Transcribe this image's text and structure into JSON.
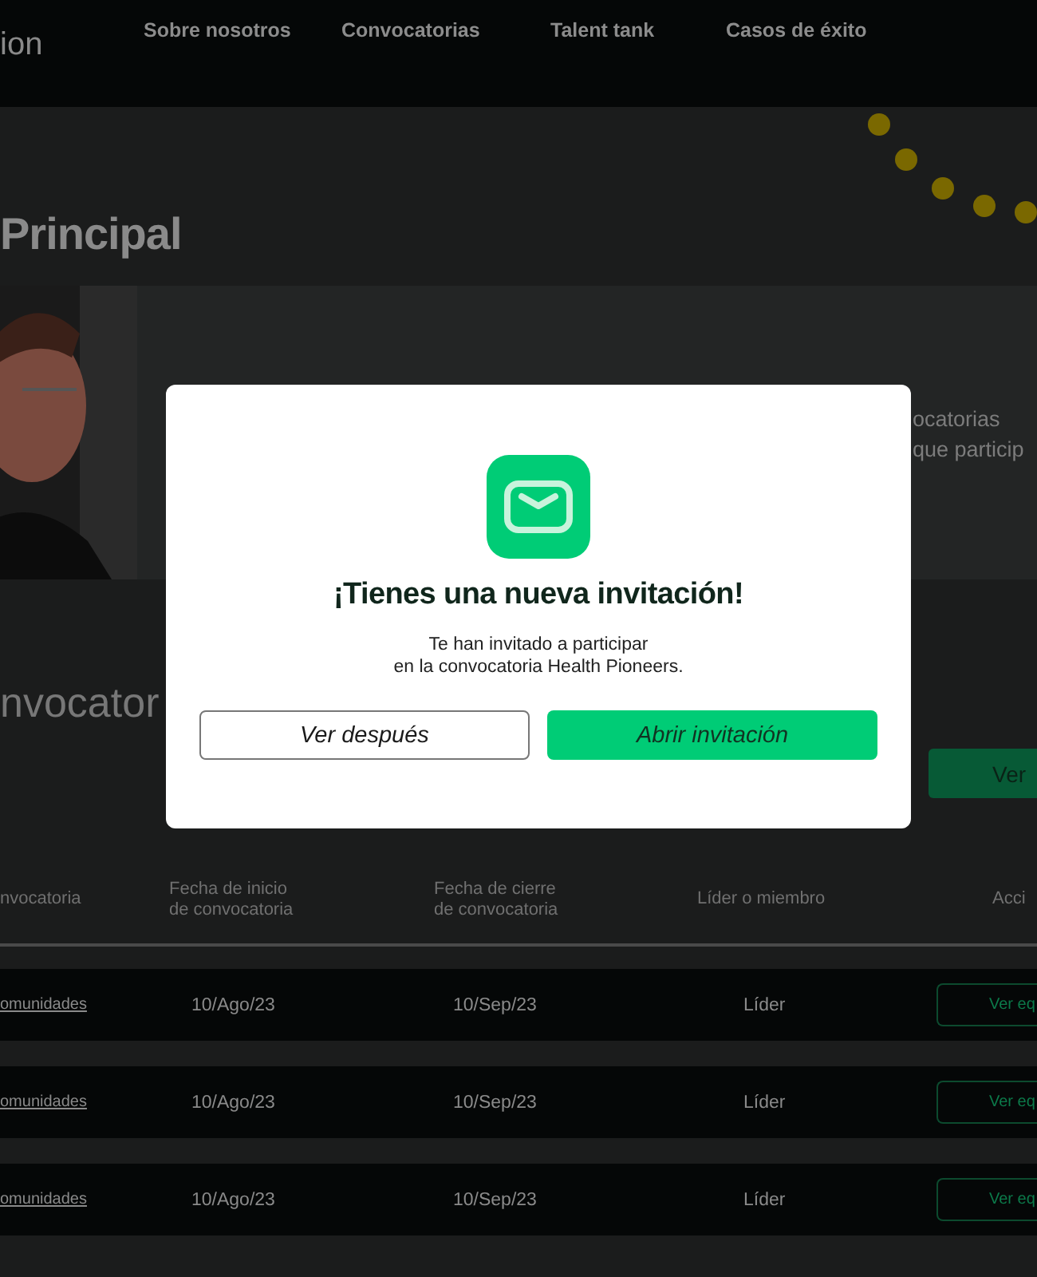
{
  "header": {
    "logo": "ion",
    "nav": [
      {
        "label": "Sobre nosotros"
      },
      {
        "label": "Convocatorias"
      },
      {
        "label": "Talent tank"
      },
      {
        "label": "Casos de éxito"
      }
    ]
  },
  "page_title": "Principal",
  "profile_card": {
    "photo": {
      "kind": "picture"
    },
    "text_lines": [
      "ocatorias",
      "que particip"
    ]
  },
  "section_title": "nvocator",
  "section_button": "Ver",
  "table": {
    "columns": [
      "nvocatoria",
      "Fecha de inicio de convocatoria",
      "Fecha de cierre de convocatoria",
      "Líder o miembro",
      "Acci"
    ],
    "rows": [
      {
        "convocatoria": "omunidades",
        "start": "10/Ago/23",
        "end": "10/Sep/23",
        "role": "Líder",
        "action": "Ver eq"
      },
      {
        "convocatoria": "omunidades",
        "start": "10/Ago/23",
        "end": "10/Sep/23",
        "role": "Líder",
        "action": "Ver eq"
      },
      {
        "convocatoria": "omunidades",
        "start": "10/Ago/23",
        "end": "10/Sep/23",
        "role": "Líder",
        "action": "Ver eq"
      }
    ]
  },
  "modal": {
    "title": "¡Tienes una nueva invitación!",
    "message": [
      "Te han invitado a participar",
      "en la convocatoria Health Pioneers."
    ],
    "buttons": [
      {
        "label": "Ver después",
        "kind": "secondary"
      },
      {
        "label": "Abrir invitación",
        "kind": "primary"
      }
    ]
  }
}
